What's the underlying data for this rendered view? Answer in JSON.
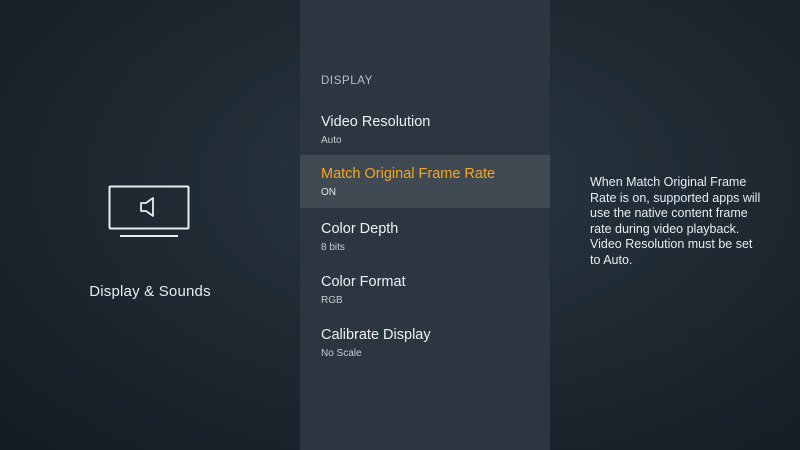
{
  "category": {
    "title": "Display & Sounds",
    "icon": "tv-sound-icon"
  },
  "menu": {
    "section_header": "DISPLAY",
    "items": [
      {
        "label": "Video Resolution",
        "value": "Auto",
        "selected": false
      },
      {
        "label": "Match Original Frame Rate",
        "value": "ON",
        "selected": true
      },
      {
        "label": "Color Depth",
        "value": "8 bits",
        "selected": false
      },
      {
        "label": "Color Format",
        "value": "RGB",
        "selected": false
      },
      {
        "label": "Calibrate Display",
        "value": "No Scale",
        "selected": false
      }
    ]
  },
  "description": {
    "text": "When Match Original Frame Rate is on, supported apps will use the native content frame rate during video playback. Video Resolution must be set to Auto."
  },
  "colors": {
    "accent": "#f5a623",
    "background": "#1f2a33",
    "menu_background": "#2b3640",
    "selected_row": "#3f4a53",
    "text": "#eef1f3"
  }
}
